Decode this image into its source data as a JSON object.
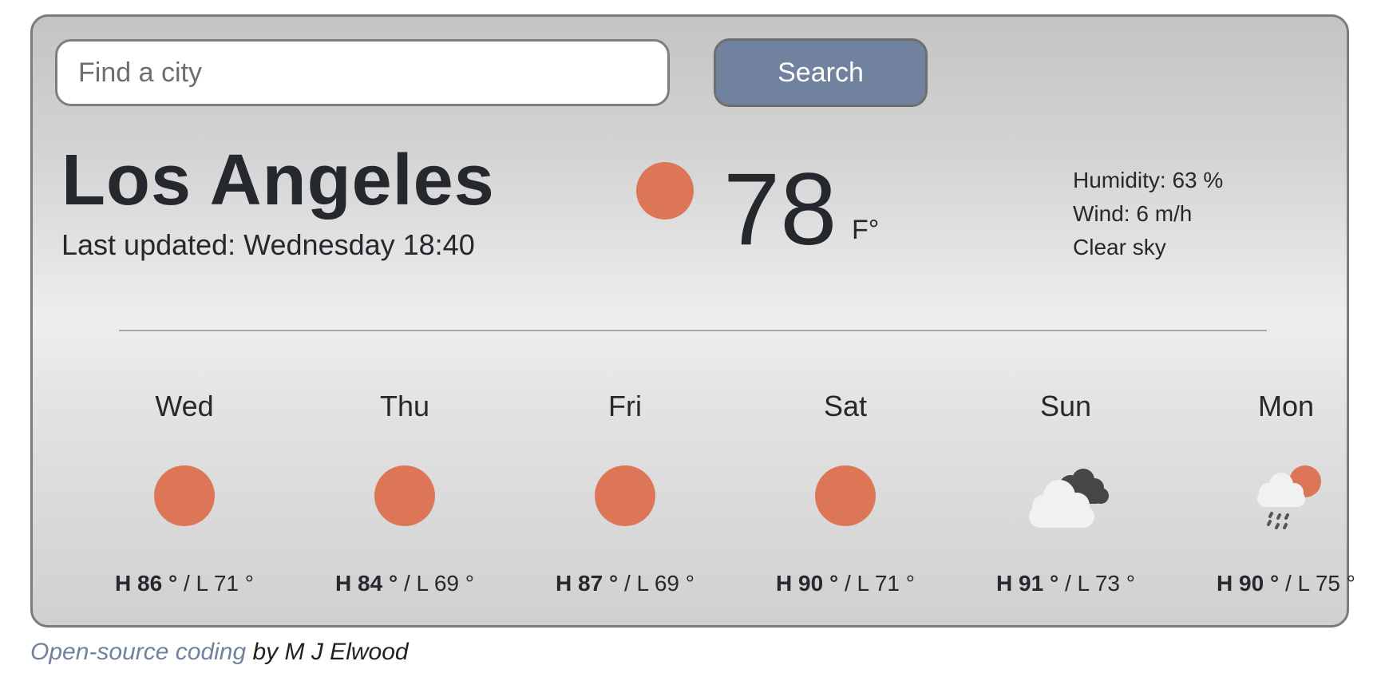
{
  "search": {
    "placeholder": "Find a city",
    "value": "",
    "button_label": "Search"
  },
  "current": {
    "city": "Los Angeles",
    "last_updated": "Last updated: Wednesday 18:40",
    "icon": "sun-icon",
    "temperature": "78",
    "unit": "F°",
    "humidity": "Humidity: 63 %",
    "wind": "Wind: 6 m/h",
    "description": "Clear sky"
  },
  "forecast": [
    {
      "day": "Wed",
      "icon": "sun-icon",
      "high": "H 86 °",
      "low": "L 71 °"
    },
    {
      "day": "Thu",
      "icon": "sun-icon",
      "high": "H 84 °",
      "low": "L 69 °"
    },
    {
      "day": "Fri",
      "icon": "sun-icon",
      "high": "H 87 °",
      "low": "L 69 °"
    },
    {
      "day": "Sat",
      "icon": "sun-icon",
      "high": "H 90 °",
      "low": "L 71 °"
    },
    {
      "day": "Sun",
      "icon": "broken-clouds-icon",
      "high": "H 91 °",
      "low": "L 73 °"
    },
    {
      "day": "Mon",
      "icon": "rain-sun-icon",
      "high": "H 90 °",
      "low": "L 75 °"
    }
  ],
  "footer": {
    "link_text": "Open-source coding",
    "by_text": " by M J Elwood"
  },
  "colors": {
    "accent": "#70829d",
    "sun": "#dd7656",
    "text": "#25282d",
    "border": "#7b7b7b"
  }
}
